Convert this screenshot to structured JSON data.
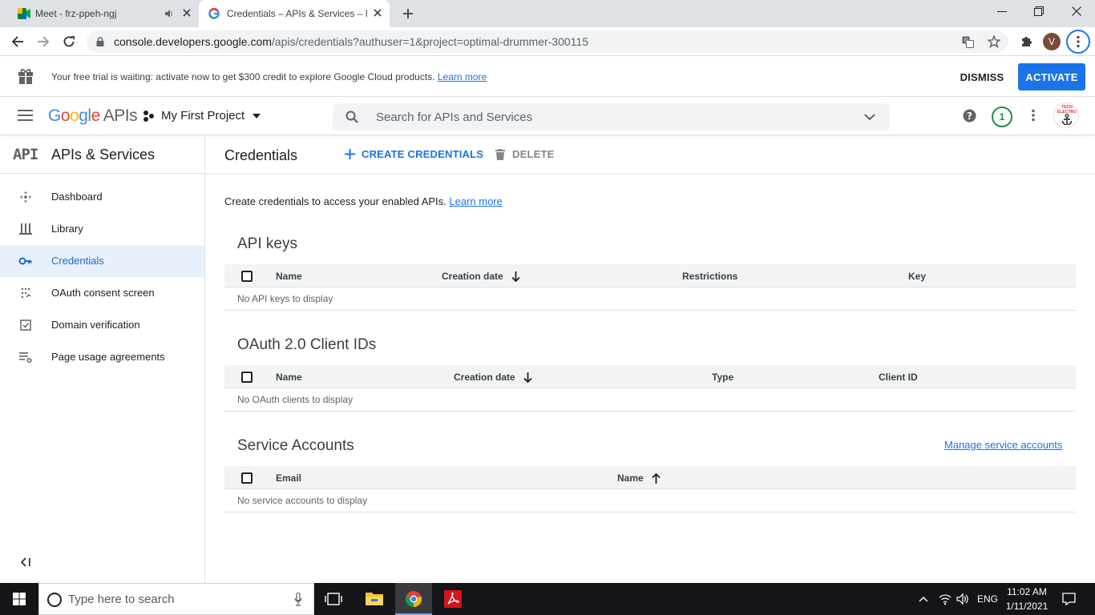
{
  "browser": {
    "tabs": [
      {
        "title": "Meet - frz-ppeh-ngj",
        "icon": "google-meet-icon",
        "audio": "speaker-icon"
      },
      {
        "title": "Credentials – APIs & Services – M",
        "icon": "google-g-icon",
        "active": true
      }
    ],
    "url_host": "console.developers.google.com",
    "url_path": "/apis/credentials?authuser=1&project=optimal-drummer-300115",
    "profile_initial": "V"
  },
  "banner": {
    "message": "Your free trial is waiting: activate now to get $300 credit to explore Google Cloud products.",
    "learn_more": "Learn more",
    "dismiss": "DISMISS",
    "activate": "ACTIVATE"
  },
  "header": {
    "logo_letters": [
      "G",
      "o",
      "o",
      "g",
      "l",
      "e"
    ],
    "logo_suffix": "APIs",
    "project": "My First Project",
    "search_placeholder": "Search for APIs and Services",
    "notification_count": "1",
    "avatar_text": "TECH ELECTRO"
  },
  "sidenav": {
    "api_label": "API",
    "title": "APIs & Services",
    "items": [
      {
        "label": "Dashboard",
        "icon": "dashboard-icon"
      },
      {
        "label": "Library",
        "icon": "library-icon"
      },
      {
        "label": "Credentials",
        "icon": "key-icon",
        "active": true
      },
      {
        "label": "OAuth consent screen",
        "icon": "consent-icon"
      },
      {
        "label": "Domain verification",
        "icon": "checkbox-icon"
      },
      {
        "label": "Page usage agreements",
        "icon": "settings-list-icon"
      }
    ]
  },
  "page": {
    "title": "Credentials",
    "create_credentials": "CREATE CREDENTIALS",
    "delete": "DELETE",
    "intro": "Create credentials to access your enabled APIs.",
    "intro_link": "Learn more"
  },
  "api_keys": {
    "title": "API keys",
    "columns": [
      "Name",
      "Creation date",
      "Restrictions",
      "Key"
    ],
    "empty": "No API keys to display"
  },
  "oauth": {
    "title": "OAuth 2.0 Client IDs",
    "columns": [
      "Name",
      "Creation date",
      "Type",
      "Client ID"
    ],
    "empty": "No OAuth clients to display"
  },
  "service_accounts": {
    "title": "Service Accounts",
    "manage_link": "Manage service accounts",
    "columns": [
      "Email",
      "Name"
    ],
    "empty": "No service accounts to display"
  },
  "taskbar": {
    "search_placeholder": "Type here to search",
    "language": "ENG",
    "time": "11:02 AM",
    "date": "1/11/2021"
  },
  "colors": {
    "accent": "#1a73e8",
    "taskbar": "#141518"
  }
}
